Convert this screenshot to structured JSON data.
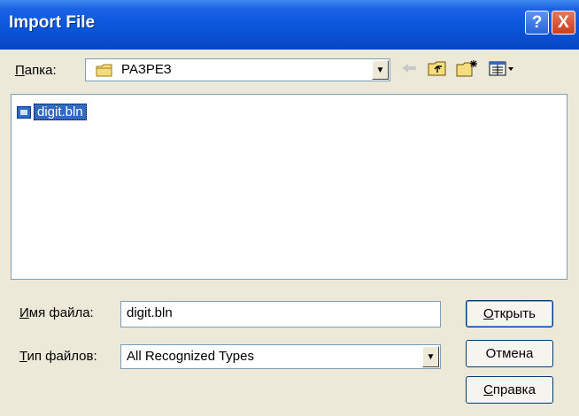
{
  "window": {
    "title": "Import File",
    "help_glyph": "?",
    "close_glyph": "X"
  },
  "folder": {
    "label_u": "П",
    "label_rest": "апка:",
    "value": "РАЗРЕЗ",
    "icon": "folder-icon"
  },
  "toolbar": {
    "back_icon": "back-arrow-icon",
    "up_icon": "up-folder-icon",
    "new_icon": "new-folder-icon",
    "view_icon": "view-menu-icon"
  },
  "files": [
    {
      "name": "digit.bln",
      "icon": "file-icon",
      "selected": true
    }
  ],
  "filename": {
    "label_u": "И",
    "label_rest": "мя файла:",
    "value": "digit.bln"
  },
  "filetype": {
    "label_u": "Т",
    "label_rest": "ип файлов:",
    "value": "All Recognized Types"
  },
  "buttons": {
    "open_u": "О",
    "open_rest": "ткрыть",
    "cancel": "Отмена",
    "help_u": "С",
    "help_rest": "правка"
  },
  "colors": {
    "titlebar": "#0a56db",
    "selection": "#316ac5",
    "dialog_bg": "#ece9d8"
  }
}
